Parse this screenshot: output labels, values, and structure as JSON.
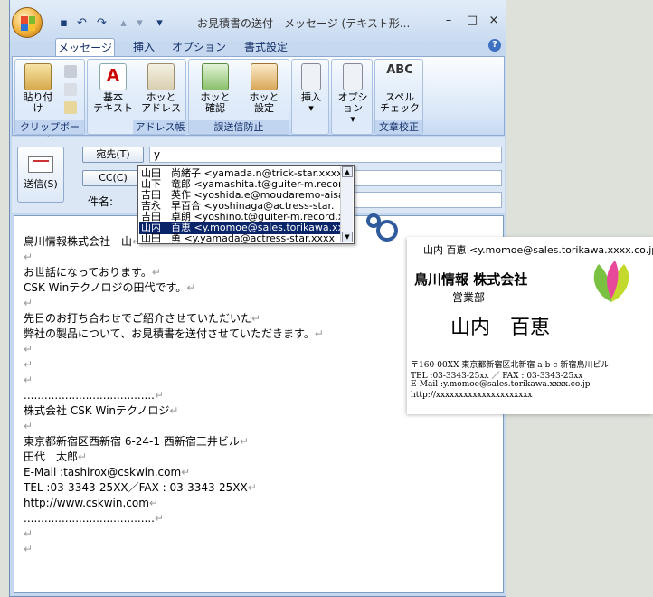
{
  "window": {
    "title": "お見積書の送付 - メッセージ (テキスト形...",
    "controls": {
      "minimize": "–",
      "maximize": "□",
      "close": "×"
    },
    "help": "?"
  },
  "tabs": [
    "メッセージ",
    "挿入",
    "オプション",
    "書式設定"
  ],
  "ribbon": {
    "groups": {
      "clipboard": "クリップボード",
      "address": "アドレス帳",
      "misdelivery": "誤送信防止",
      "proofing": "文章校正"
    },
    "paste": "貼り付け",
    "basic_text": [
      "基本",
      "テキスト"
    ],
    "hot_address": [
      "ホッと",
      "アドレス"
    ],
    "hot_confirm": [
      "ホッと",
      "確認"
    ],
    "hot_settings": [
      "ホッと",
      "設定"
    ],
    "insert": "挿入",
    "options": "オプション",
    "spell": [
      "スペル",
      "チェック"
    ],
    "abc": "ABC"
  },
  "header": {
    "send_label": "送信(S)",
    "to_label": "宛先(T)",
    "cc_label": "CC(C)",
    "subject_label": "件名:",
    "to_value": "y"
  },
  "autocomplete": [
    "山田　尚緒子 <yamada.n@trick-star.xxxx",
    "山下　竜郎 <yamashita.t@guiter-m.record",
    "吉田　英作 <yoshida.e@moudaremo-aisa",
    "吉永　早百合 <yoshinaga@actress-star.",
    "吉田　卓朗 <yoshino.t@guiter-m.record.x",
    "山内　百恵 <y.momoe@sales.torikawa.xx",
    "山田　勇 <y.yamada@actress-star.xxxx"
  ],
  "selected_index": 5,
  "body_lines": [
    "鳥川情報株式会社　山",
    "",
    "お世話になっております。",
    "CSK Winテクノロジの田代です。",
    "",
    "先日のお打ち合わせでご紹介させていただいた",
    "弊社の製品について、お見積書を送付させていただきます。",
    "",
    "",
    "",
    "......................................",
    "株式会社 CSK Winテクノロジ",
    " ",
    "東京都新宿区西新宿 6-24-1 西新宿三井ビル",
    "田代　太郎",
    "E-Mail :tashirox@cskwin.com",
    "TEL :03-3343-25XX／FAX : 03-3343-25XX",
    "http://www.cskwin.com",
    " ......................................",
    "",
    ""
  ],
  "paragraph_mark": "↵",
  "card": {
    "header": "山内 百恵 <y.momoe@sales.torikawa.xxxx.co.jp>",
    "company": "鳥川情報 株式会社",
    "dept": "営業部",
    "name": "山内　百恵",
    "address": "〒160-00XX 東京都新宿区北新宿 a-b-c 新宿鳥川ビル",
    "tel": "TEL :03-3343-25xx ／ FAX : 03-3343-25xx",
    "email": "E-Mail :y.momoe@sales.torikawa.xxxx.co.jp",
    "url": "http://xxxxxxxxxxxxxxxxxxxxx"
  },
  "colors": {
    "selection": "#0a246a",
    "ring": "#2f5b9c",
    "ribbon": "#c5d8ef"
  }
}
